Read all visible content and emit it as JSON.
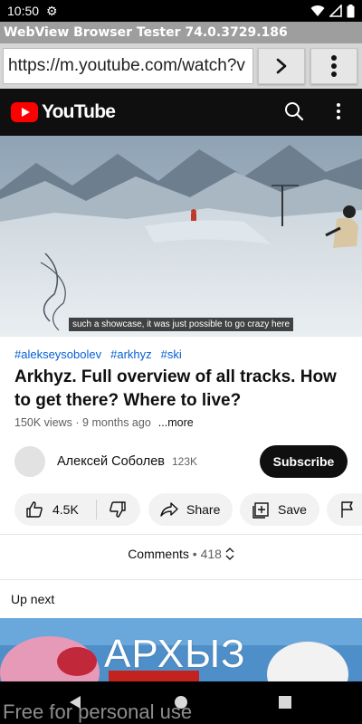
{
  "status_bar": {
    "time": "10:50"
  },
  "browser": {
    "app_title": "WebView Browser Tester 74.0.3729.186",
    "url": "https://m.youtube.com/watch?v",
    "go_label": "",
    "menu_label": ""
  },
  "youtube": {
    "logo_text": "YouTube",
    "caption": "such a showcase, it was just possible to go crazy here",
    "hashtags": [
      "#alekseysobolev",
      "#arkhyz",
      "#ski"
    ],
    "title": "Arkhyz. Full overview of all tracks. How to get there? Where to live?",
    "views_time": "150K views · 9 months ago",
    "more_label": "...more",
    "channel": {
      "name": "Алексей Соболев",
      "subscribers": "123K",
      "subscribe_label": "Subscribe"
    },
    "actions": {
      "like_count": "4.5K",
      "share_label": "Share",
      "save_label": "Save"
    },
    "comments": {
      "label": "Comments",
      "separator": "•",
      "count": "418"
    },
    "up_next_label": "Up next",
    "thumbnail_text": "АРХЫЗ"
  },
  "watermark": "Free for personal use",
  "colors": {
    "youtube_red": "#ff0000",
    "header_bg": "#0f0f0f",
    "hashtag": "#065fd4",
    "app_title_bg": "#9e9e9e"
  }
}
